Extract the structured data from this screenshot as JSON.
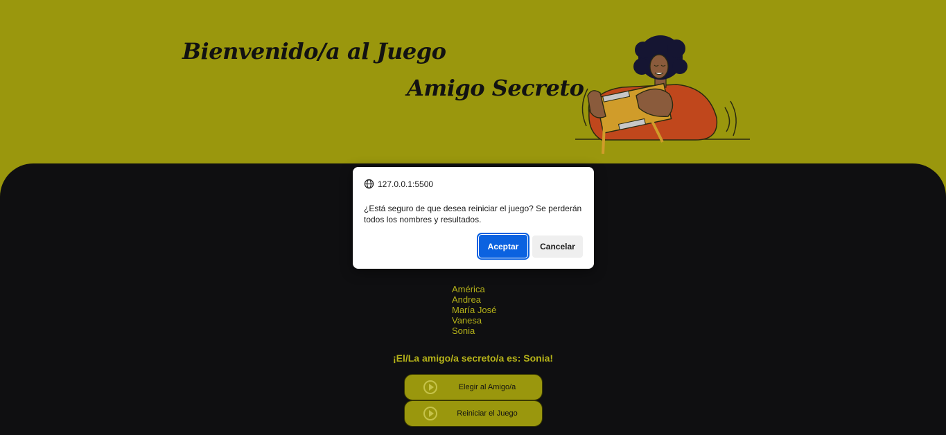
{
  "header": {
    "title_line1": "Bienvenido/a al Juego",
    "title_line2": "Amigo Secreto",
    "illustration_icon": "person-holding-gift-illustration"
  },
  "main": {
    "friends": [
      "América",
      "Andrea",
      "María José",
      "Vanesa",
      "Sonia"
    ],
    "result_text": "¡El/La amigo/a secreto/a es: Sonia!",
    "draw_button": "Elegir al Amigo/a",
    "reset_button": "Reiniciar el Juego"
  },
  "dialog": {
    "origin": "127.0.0.1:5500",
    "message": "¿Está seguro de que desea reiniciar el juego? Se perderán todos los nombres y resultados.",
    "ok_label": "Aceptar",
    "cancel_label": "Cancelar"
  },
  "colors": {
    "brand_olive": "#9a970d",
    "dark_background": "#0f0f11",
    "accent_text": "#b5b219",
    "dialog_primary": "#0b62e0"
  }
}
